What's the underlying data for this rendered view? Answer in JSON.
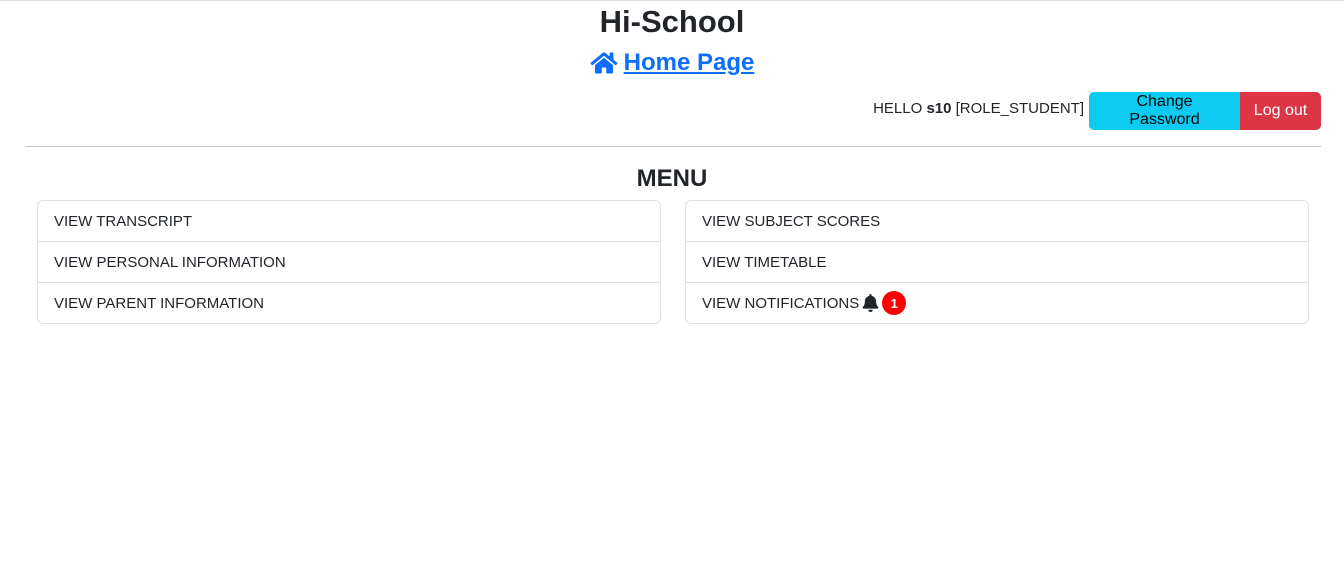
{
  "header": {
    "title": "Hi-School",
    "home_link": "Home Page"
  },
  "user": {
    "hello": "HELLO",
    "username": "s10",
    "role": "[ROLE_STUDENT]",
    "change_password_label": "Change Password",
    "logout_label": "Log out"
  },
  "menu": {
    "title": "MENU",
    "left_items": [
      {
        "label": "VIEW TRANSCRIPT"
      },
      {
        "label": "VIEW PERSONAL INFORMATION"
      },
      {
        "label": "VIEW PARENT INFORMATION"
      }
    ],
    "right_items": [
      {
        "label": "VIEW SUBJECT SCORES"
      },
      {
        "label": "VIEW TIMETABLE"
      },
      {
        "label": "VIEW NOTIFICATIONS",
        "icon": "bell-icon",
        "badge": "1"
      }
    ]
  },
  "colors": {
    "link": "#0d6efd",
    "info_button": "#0dcaf0",
    "danger_button": "#dc3545",
    "badge": "#ff0000"
  }
}
